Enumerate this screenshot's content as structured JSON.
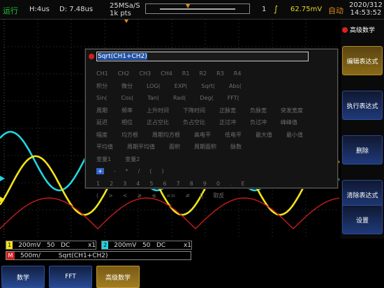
{
  "topbar": {
    "status": "运行",
    "h_scale": "H:4us",
    "delay": "D: 7.48us",
    "sample_rate": "25MSa/S",
    "mem_depth": "1k pts",
    "trigger_source": "1",
    "trigger_edge_icon": "rising-edge-icon",
    "trigger_level": "62.75mV",
    "mode": "自动",
    "date": "2020/312",
    "time": "14:53:52"
  },
  "side_menu": {
    "title": "高级数学",
    "buttons": [
      {
        "label": "编辑表达式",
        "active": true
      },
      {
        "label": "执行表达式",
        "active": false
      },
      {
        "label": "删除",
        "active": false
      },
      {
        "label": "清除表达式",
        "active": false
      },
      {
        "label": "设置",
        "active": false
      }
    ]
  },
  "dialog": {
    "expression": "Sqrt(CH1+CH2)",
    "keyboard_rows": [
      [
        "CH1",
        "CH2",
        "CH3",
        "CH4",
        "R1",
        "R2",
        "R3",
        "R4"
      ],
      [
        "积分",
        "微分",
        "LOG(",
        "EXP(",
        "Sqrt(",
        "Abs("
      ],
      [
        "Sin(",
        "Cos(",
        "Tan(",
        "Rad(",
        "Deg(",
        "FFT("
      ],
      [
        "周期",
        "频率",
        "上升时间",
        "下降时间",
        "正脉宽",
        "负脉宽",
        "突发宽度"
      ],
      [
        "延迟",
        "相位",
        "正占空比",
        "负占空比",
        "正过冲",
        "负过冲",
        "峰峰值"
      ],
      [
        "幅度",
        "均方根",
        "周期均方根",
        "高电平",
        "低电平",
        "最大值",
        "最小值"
      ],
      [
        "平均值",
        "周期平均值",
        "面积",
        "周期面积",
        "脉数"
      ],
      [
        "变量1",
        "变量2"
      ],
      [
        "+",
        "-",
        "*",
        "/",
        "(",
        ")"
      ],
      [
        "1",
        "2",
        "3",
        "4",
        "5",
        "6",
        "7",
        "8",
        "9",
        "0",
        ".",
        "E"
      ],
      [
        "(",
        "&gt;",
        "&lt;",
        "≥",
        "≤",
        "==",
        "≠",
        "||",
        "取反"
      ]
    ],
    "selected_key": "+"
  },
  "channels": [
    {
      "label": "1",
      "text": "200mV   50   DC         x1",
      "color": "#f2e418"
    },
    {
      "label": "2",
      "text": "200mV   50   DC         x1",
      "color": "#22d4e0"
    },
    {
      "label": "M",
      "text": "500m/         Sqrt(CH1+CH2)",
      "color": "#d02020"
    }
  ],
  "softkeys": [
    {
      "label": "数学",
      "active": false
    },
    {
      "label": "FFT",
      "active": false
    },
    {
      "label": "高级数学",
      "active": true
    }
  ],
  "colors": {
    "ch1": "#f2e418",
    "ch2": "#22d4e0",
    "math": "#d02020",
    "trigger": "#e08a1e"
  }
}
